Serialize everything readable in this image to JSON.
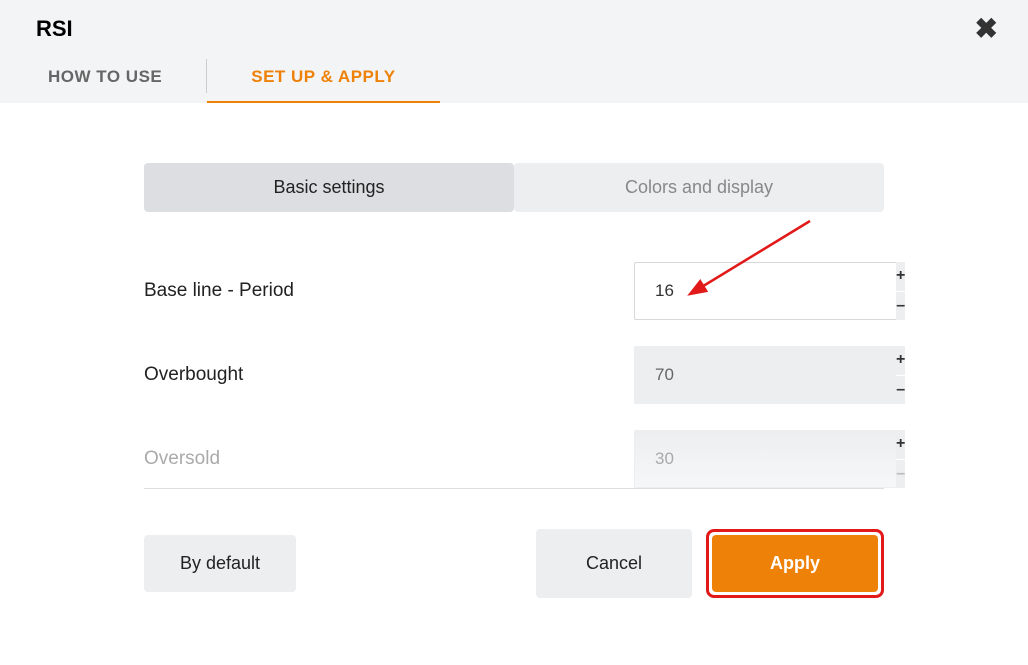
{
  "header": {
    "title": "RSI",
    "close_label": "✖"
  },
  "tabs": {
    "how_to_use": "HOW TO USE",
    "setup_apply": "SET UP & APPLY"
  },
  "subtabs": {
    "basic": "Basic settings",
    "colors": "Colors and display"
  },
  "fields": {
    "baseline": {
      "label": "Base line - Period",
      "value": "16"
    },
    "overbought": {
      "label": "Overbought",
      "value": "70"
    },
    "oversold": {
      "label": "Oversold",
      "value": "30"
    }
  },
  "stepper": {
    "plus": "+",
    "minus": "–"
  },
  "footer": {
    "default": "By default",
    "cancel": "Cancel",
    "apply": "Apply"
  },
  "colors": {
    "accent": "#ee8208",
    "highlight": "#e11919"
  }
}
